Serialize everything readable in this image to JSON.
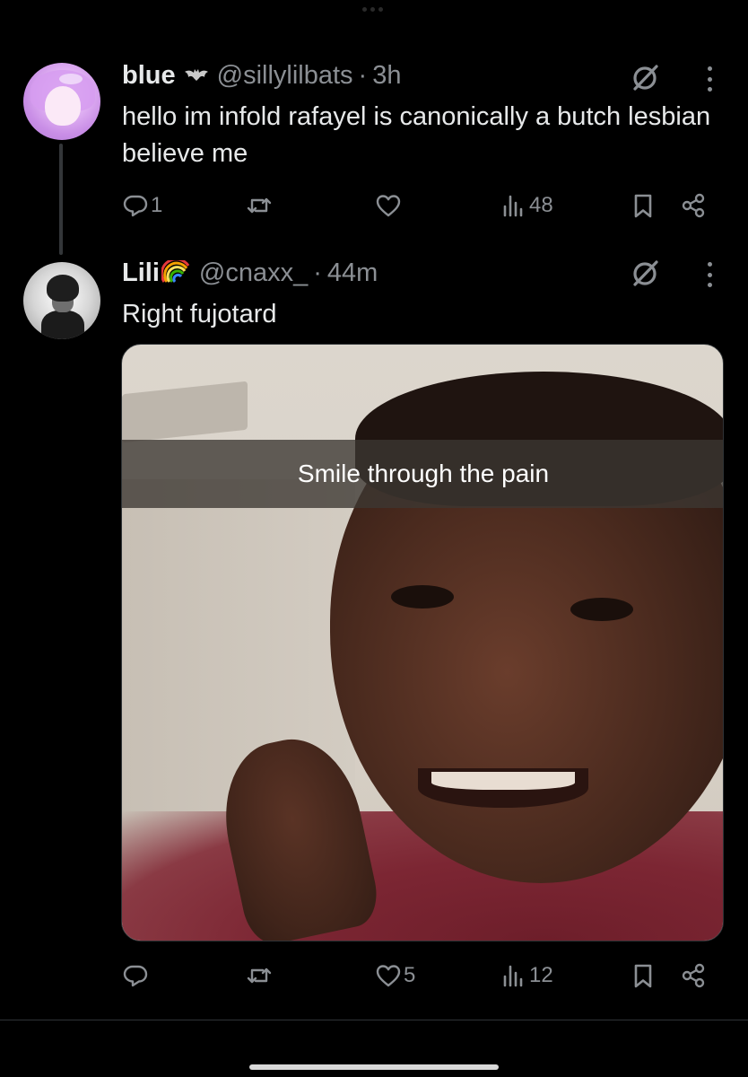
{
  "tweets": [
    {
      "display_name": "blue",
      "badge_icon": "bat-icon",
      "handle": "@sillylilbats",
      "separator": "·",
      "time": "3h",
      "text": "hello im infold rafayel is canonically a butch lesbian believe me",
      "replies": "1",
      "retweets": "",
      "likes": "",
      "views": "48"
    },
    {
      "display_name": "Lili",
      "badge_icon": "rainbow-icon",
      "handle": "@cnaxx_",
      "separator": "·",
      "time": "44m",
      "text": "Right fujotard",
      "media": {
        "caption": "Smile through the pain",
        "icon": "meme-photo"
      },
      "replies": "",
      "retweets": "",
      "likes": "5",
      "views": "12"
    }
  ],
  "colors": {
    "background": "#000000",
    "text": "#e7e9ea",
    "muted": "#8b8f94",
    "divider": "#2f3336"
  }
}
